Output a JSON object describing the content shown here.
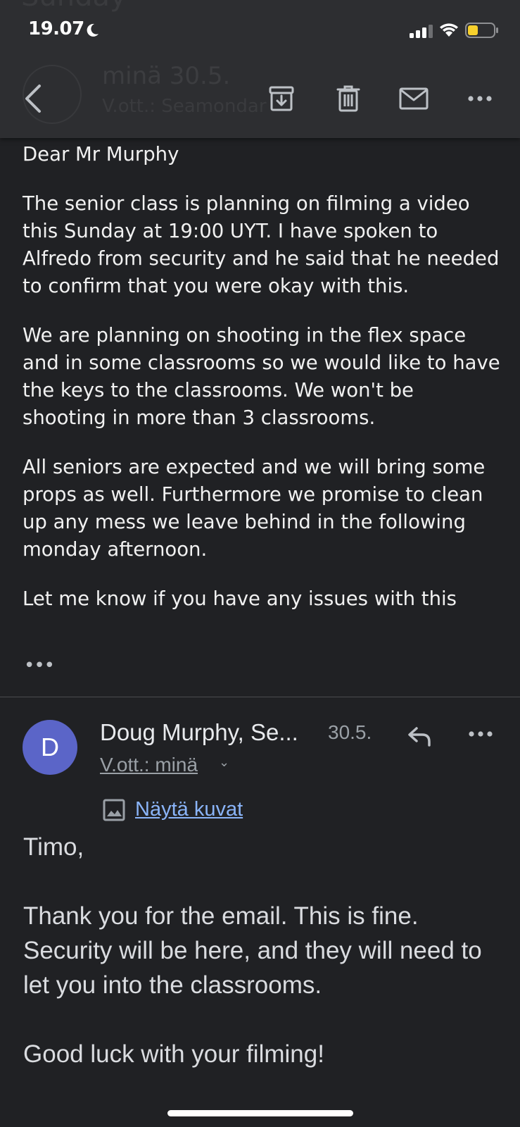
{
  "status_bar": {
    "time": "19.07"
  },
  "toolbar": {
    "ghost_title": "Sunday",
    "ghost_sender": "minä  30.5.",
    "ghost_recipient": "V.ott.: Seamondar"
  },
  "message1": {
    "paragraphs": [
      "Dear Mr Murphy",
      "The senior class is planning on filming a video this Sunday at 19:00 UYT. I have spoken to Alfredo from security and he said that he needed to confirm that you were okay with this.",
      "We are planning on shooting in the flex space and in some classrooms so we would like to have the keys to the classrooms. We won't be shooting in more than 3 classrooms.",
      "All seniors are expected and we will bring some props as well. Furthermore we promise to clean up any mess we leave behind in the following monday afternoon.",
      "Let me know if you have any issues with this"
    ],
    "more_dots": "•••"
  },
  "message2": {
    "avatar_letter": "D",
    "sender": "Doug Murphy, Se...",
    "date": "30.5.",
    "recipient": "V.ott.: minä",
    "show_images": "Näytä kuvat",
    "paragraphs": [
      "Timo,",
      "Thank you for the email. This is fine. Security will be here, and they will need to let you into the classrooms.",
      "Good luck with your filming!"
    ]
  },
  "colors": {
    "avatar": "#5b65c8",
    "link": "#8ab4f8",
    "background": "#202124",
    "toolbar": "#2d2e31",
    "battery": "#f7d02c"
  }
}
